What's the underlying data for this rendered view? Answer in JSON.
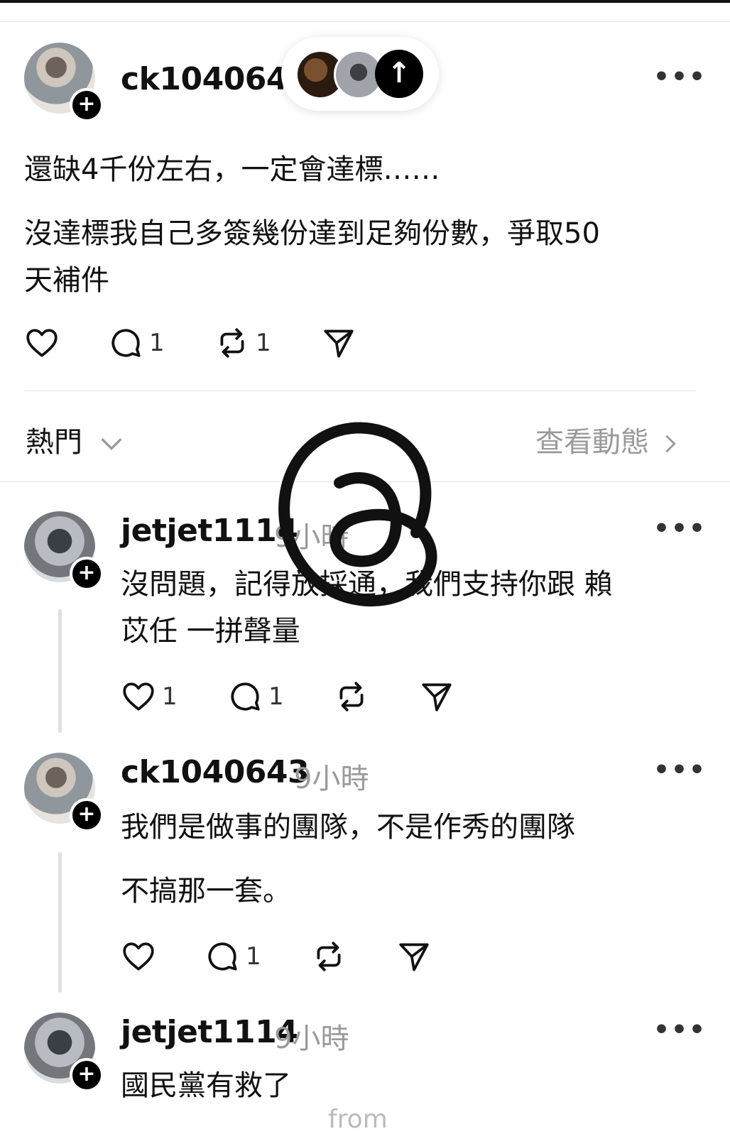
{
  "post": {
    "username": "ck1040643",
    "line1": "還缺4千份左右，一定會達標……",
    "line2a": "沒達標我自己多簽幾份達到足夠份數，爭取50",
    "line2b": "天補件",
    "likes": "",
    "replies": "1",
    "reposts": "1",
    "more": "•••"
  },
  "filter": {
    "sort_label": "熱門",
    "view_activity_label": "查看動態"
  },
  "replies": [
    {
      "username": "jetjet1114",
      "time": "9小時",
      "line1": "沒問題，記得放採通，我們支持你跟 賴",
      "line2": "苡任 一拼聲量",
      "likes": "1",
      "replies": "1",
      "reposts": ""
    },
    {
      "username": "ck1040643",
      "time": "9小時",
      "line1": "我們是做事的團隊，不是作秀的團隊",
      "line2": "不搞那一套。",
      "likes": "",
      "replies": "1",
      "reposts": ""
    },
    {
      "username": "jetjet1114",
      "time": "9小時",
      "line1": "國民黨有救了"
    }
  ],
  "watermark": {
    "footer": "from"
  },
  "icons": [
    "heart-icon",
    "comment-icon",
    "repost-icon",
    "share-icon",
    "chevron-down-icon",
    "chevron-right-icon",
    "threads-logo-icon",
    "arrow-up-icon",
    "follow-plus-icon"
  ]
}
